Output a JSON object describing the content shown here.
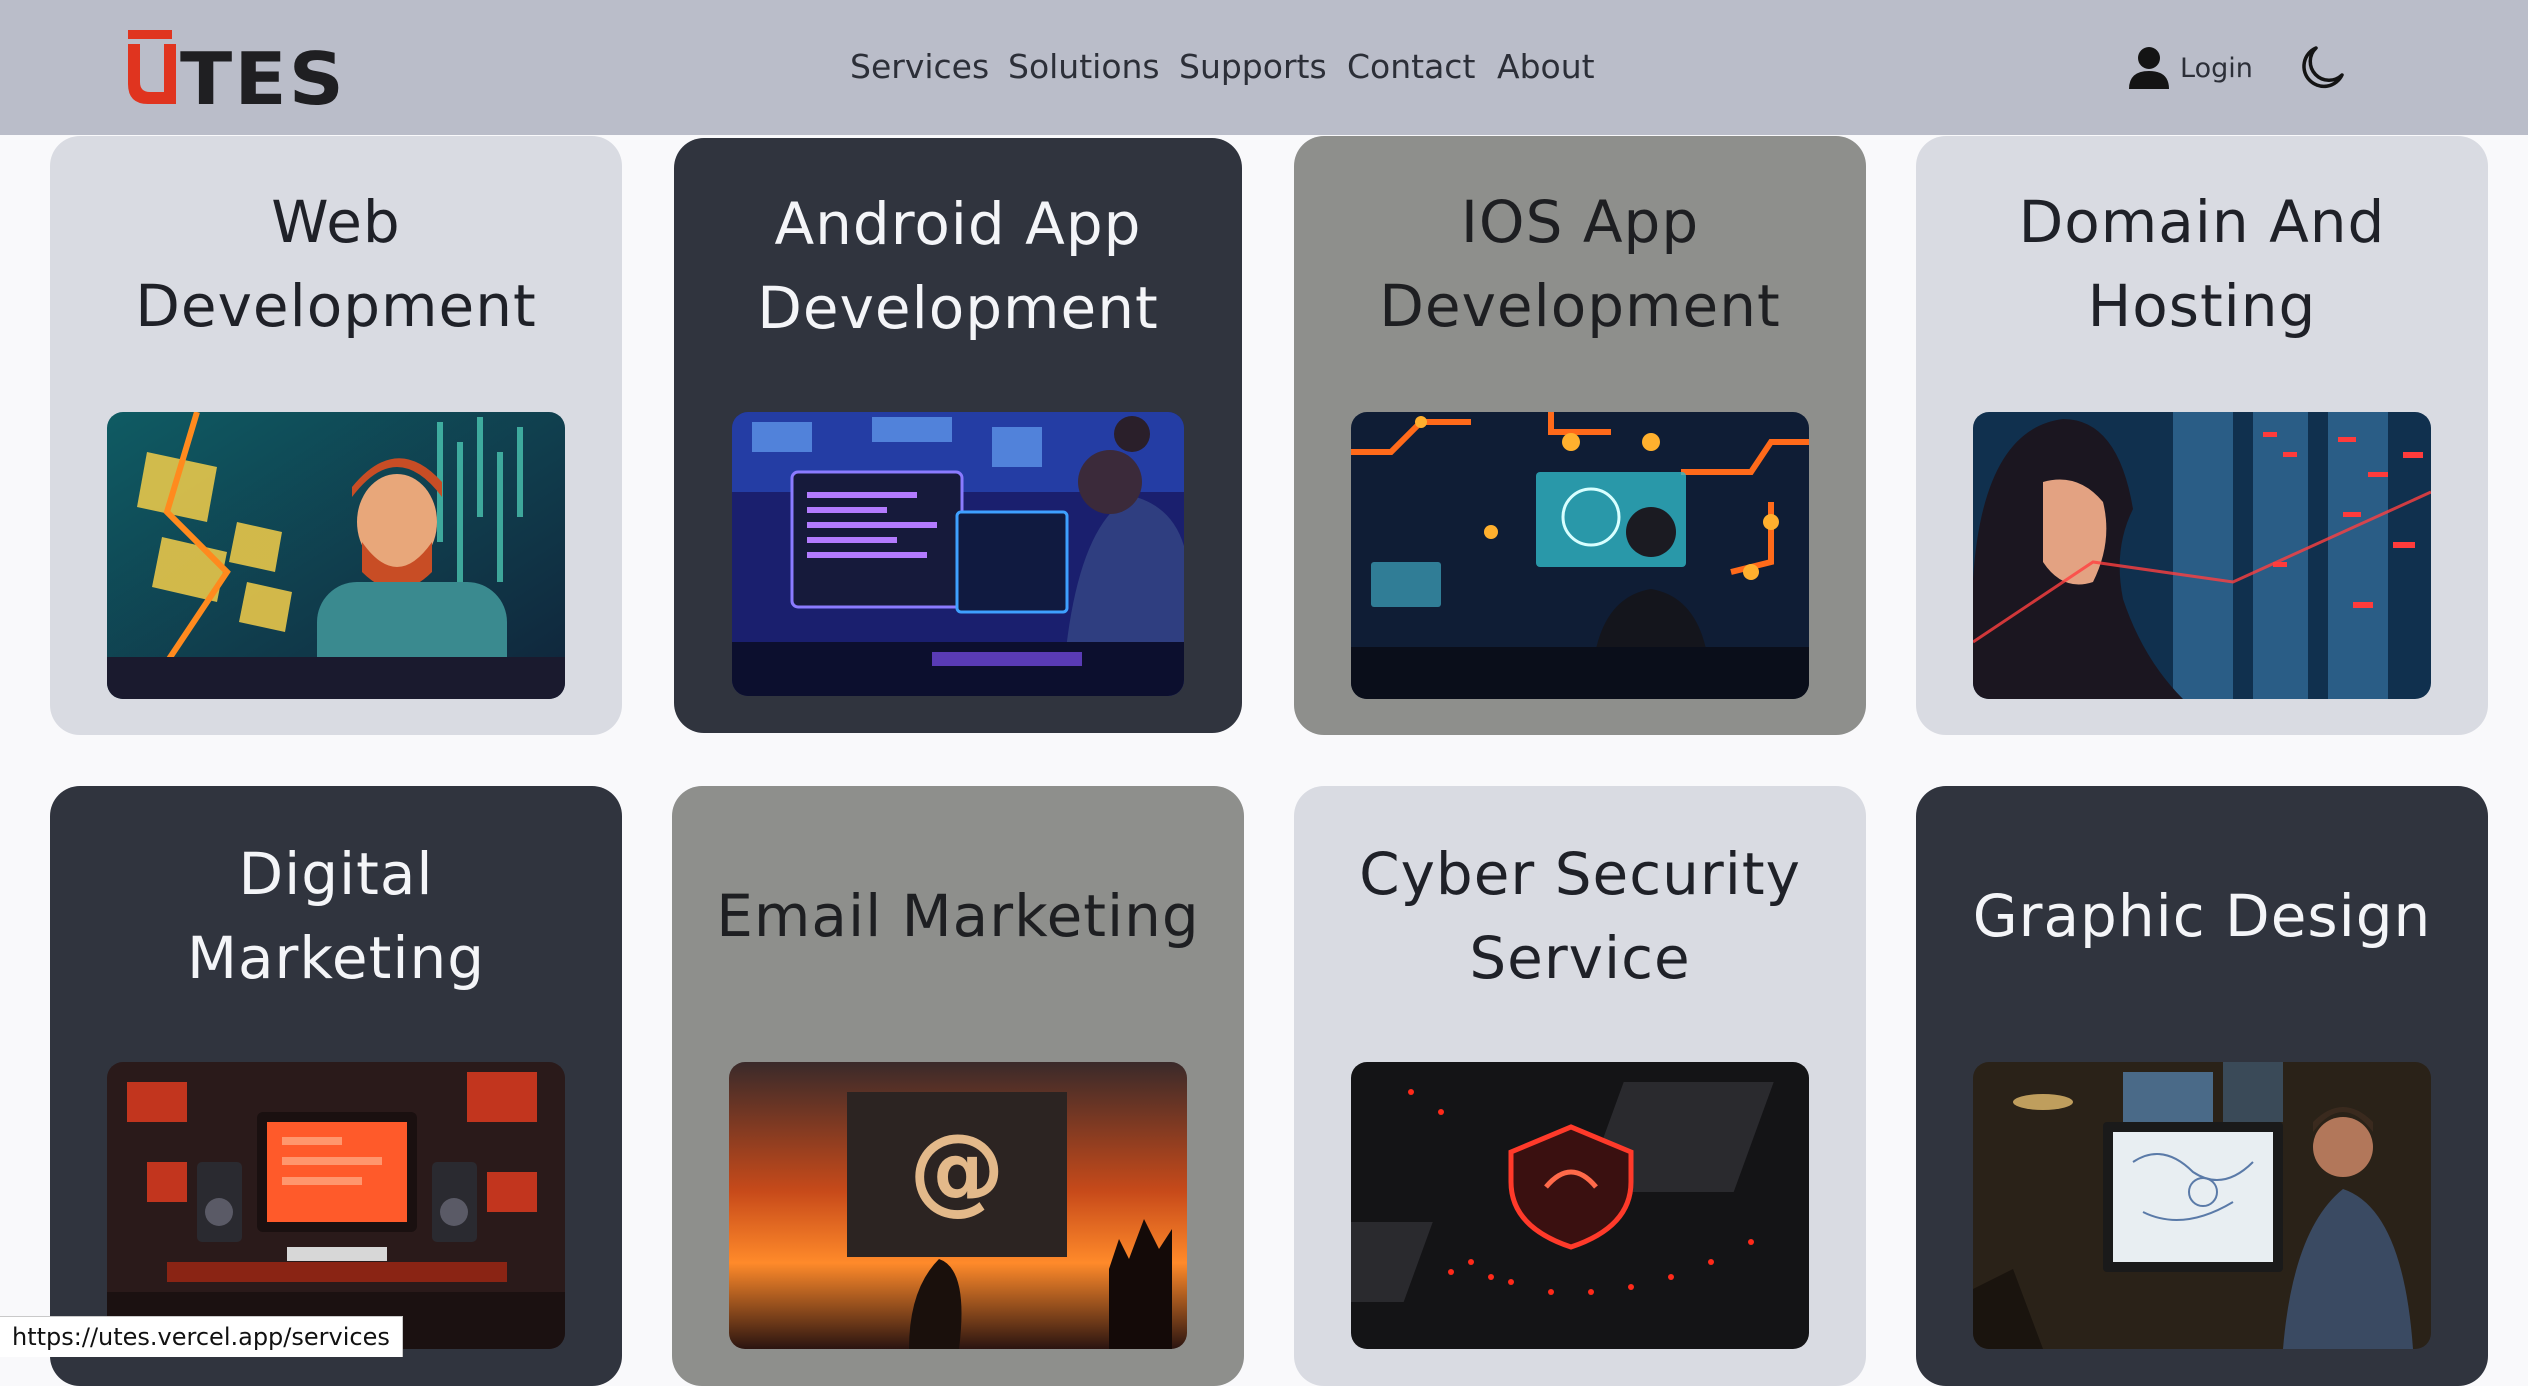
{
  "header": {
    "logo_text": "UTES",
    "nav": [
      "Services",
      "Solutions",
      "Supports",
      "Contact",
      "About"
    ],
    "login_label": "Login",
    "icons": {
      "user": "user-icon",
      "theme": "moon-icon"
    }
  },
  "services": [
    {
      "title_lines": [
        "Web",
        "Development"
      ],
      "image": "web-development-illustration"
    },
    {
      "title_lines": [
        "Android App",
        "Development"
      ],
      "image": "android-app-illustration"
    },
    {
      "title_lines": [
        "IOS App",
        "Development"
      ],
      "image": "ios-app-illustration"
    },
    {
      "title_lines": [
        "Domain And",
        "Hosting"
      ],
      "image": "domain-hosting-illustration"
    },
    {
      "title_lines": [
        "Digital",
        "Marketing"
      ],
      "image": "digital-marketing-illustration"
    },
    {
      "title_lines": [
        "Email Marketing"
      ],
      "image": "email-marketing-illustration"
    },
    {
      "title_lines": [
        "Cyber Security",
        "Service"
      ],
      "image": "cyber-security-illustration"
    },
    {
      "title_lines": [
        "Graphic Design"
      ],
      "image": "graphic-design-illustration"
    }
  ],
  "status_bar": {
    "url": "https://utes.vercel.app/services"
  },
  "colors": {
    "brand_red": "#e0341f",
    "logo_dark": "#1f1f22",
    "header_bg": "#babdc9"
  }
}
